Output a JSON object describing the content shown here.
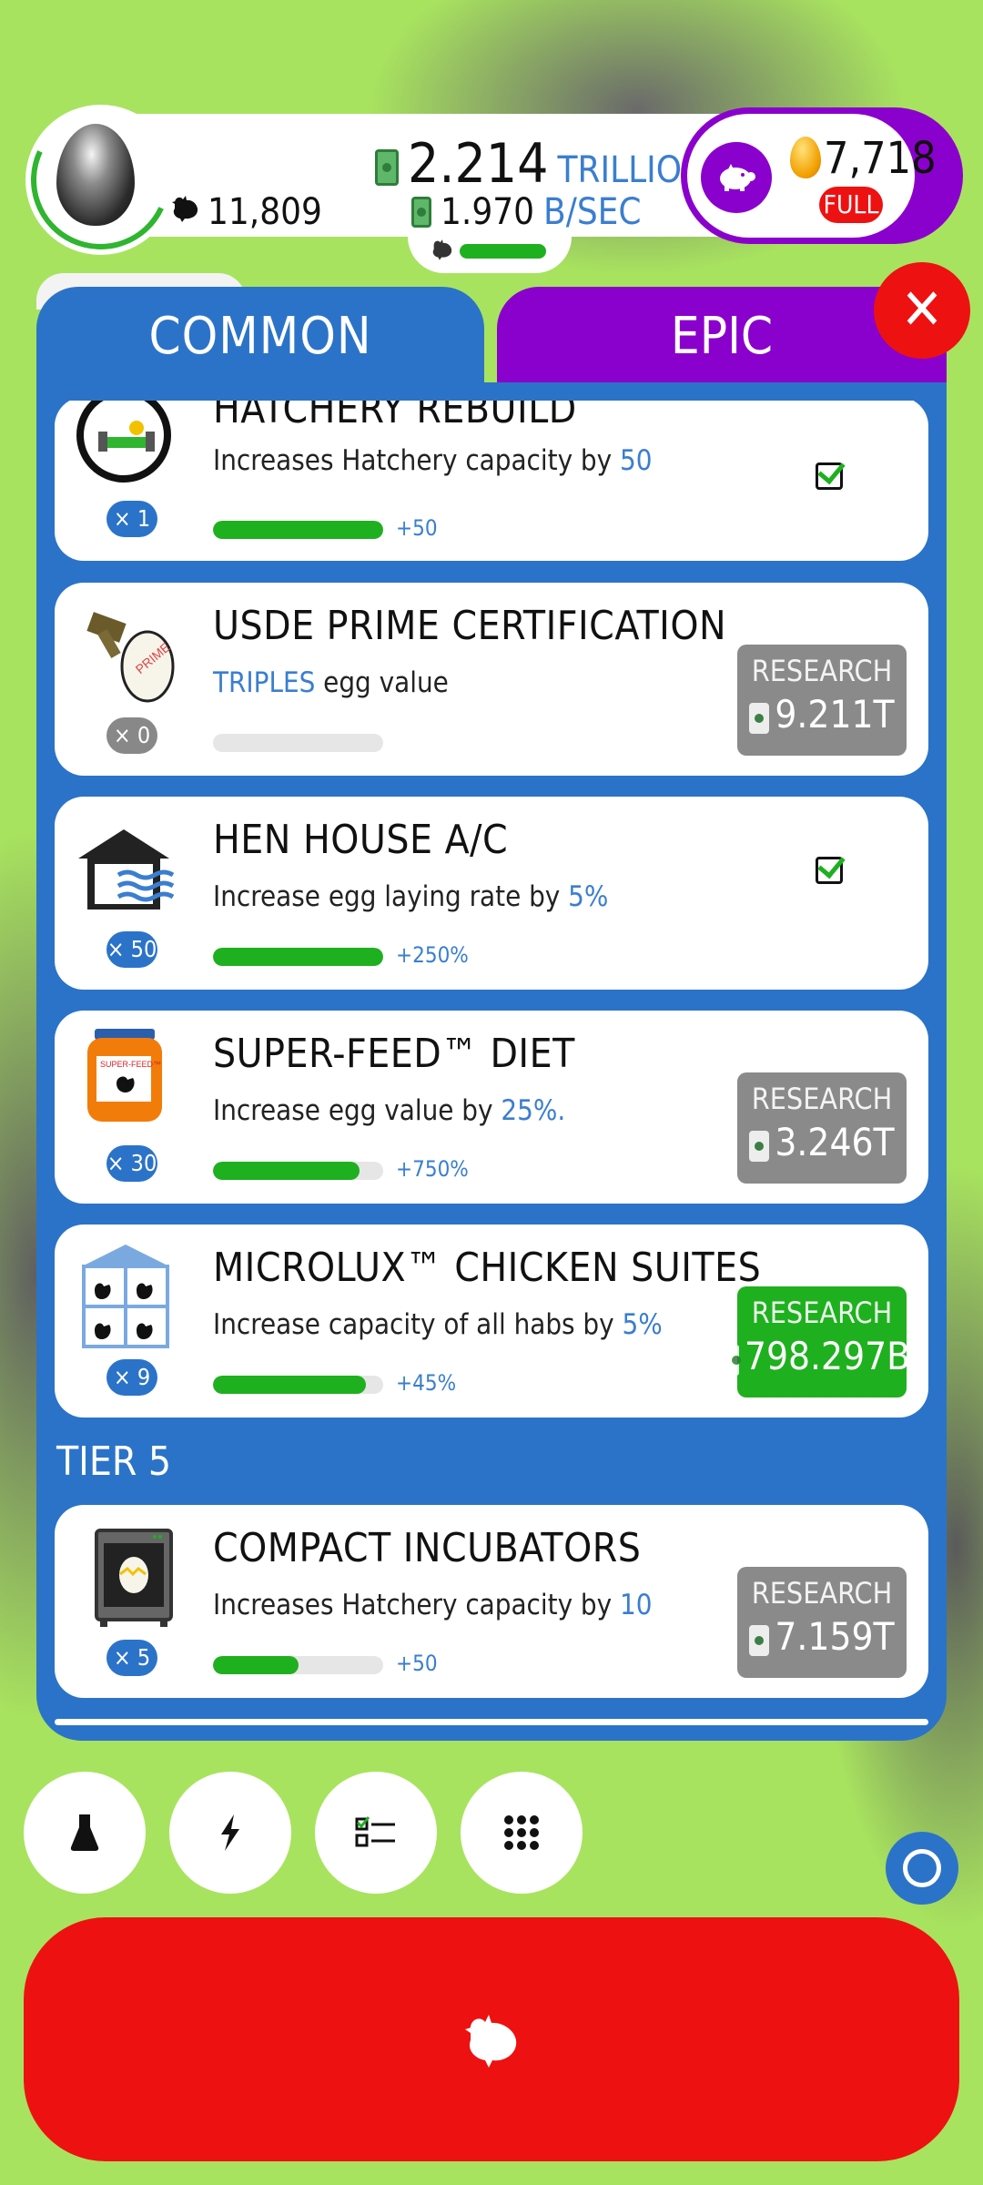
{
  "hud": {
    "chicken_count": "11,809",
    "bank_value": "2.214",
    "bank_unit": "TRILLION",
    "rate_value": "1.970",
    "rate_unit": "B/SEC",
    "golden_eggs": "7,718",
    "piggy_status": "FULL"
  },
  "tabs": {
    "common": "COMMON",
    "epic": "EPIC",
    "active": "COMMON"
  },
  "research_items": [
    {
      "title": "HATCHERY REBUILD",
      "desc_pre": "Increases Hatchery capacity by ",
      "desc_hl": "50",
      "desc_post": "",
      "level": "× 1",
      "progress": 1.0,
      "progress_text": "+50",
      "state": "complete",
      "icon": "hatchery-rebuild-icon"
    },
    {
      "title": "USDE PRIME CERTIFICATION",
      "desc_pre": "",
      "desc_hl": "TRIPLES",
      "desc_post": " egg value",
      "level": "× 0",
      "progress": 0.0,
      "progress_text": "",
      "state": "research",
      "button_label": "RESEARCH",
      "cost": "9.211T",
      "button_color": "gray",
      "icon": "prime-certification-icon"
    },
    {
      "title": "HEN HOUSE A/C",
      "desc_pre": "Increase egg laying rate by ",
      "desc_hl": "5%",
      "desc_post": "",
      "level": "× 50",
      "progress": 1.0,
      "progress_text": "+250%",
      "state": "complete",
      "icon": "hen-house-ac-icon"
    },
    {
      "title": "SUPER-FEED™ DIET",
      "desc_pre": "Increase egg value by ",
      "desc_hl": "25%",
      "desc_post": ".",
      "level": "× 30",
      "progress": 0.86,
      "progress_text": "+750%",
      "state": "research",
      "button_label": "RESEARCH",
      "cost": "3.246T",
      "button_color": "gray",
      "icon": "super-feed-icon"
    },
    {
      "title": "MICROLUX™ CHICKEN SUITES",
      "desc_pre": "Increase capacity of all habs by ",
      "desc_hl": "5%",
      "desc_post": "",
      "level": "× 9",
      "progress": 0.9,
      "progress_text": "+45%",
      "state": "research",
      "button_label": "RESEARCH",
      "cost": "798.297B",
      "button_color": "green",
      "icon": "chicken-suites-icon"
    },
    {
      "title": "COMPACT INCUBATORS",
      "desc_pre": "Increases Hatchery capacity by ",
      "desc_hl": "10",
      "desc_post": "",
      "level": "× 5",
      "progress": 0.5,
      "progress_text": "+50",
      "state": "research",
      "button_label": "RESEARCH",
      "cost": "7.159T",
      "button_color": "gray",
      "icon": "incubator-icon"
    }
  ],
  "tier_label": "TIER 5",
  "bottom_bar": {
    "buttons": [
      "research-flask-icon",
      "boost-lightning-icon",
      "missions-checklist-icon",
      "menu-grid-icon"
    ]
  },
  "colors": {
    "background": "#a8e35f",
    "panel_blue": "#2b73c8",
    "epic_purple": "#8a00cc",
    "research_green": "#1fb01f",
    "research_gray": "#8a8a8a",
    "hatch_red": "#ee1111"
  }
}
